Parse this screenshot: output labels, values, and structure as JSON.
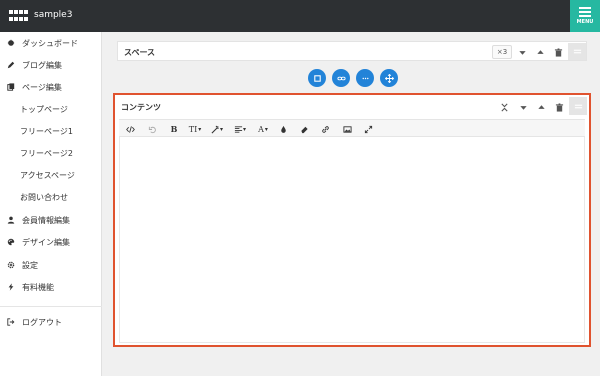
{
  "header": {
    "site_name": "sample3",
    "menu_label": "MENU",
    "colors": {
      "bar": "#2d3033",
      "menu": "#26b8a1"
    }
  },
  "sidebar": {
    "items": [
      {
        "label": "ダッシュボード",
        "icon": "dashboard-icon"
      },
      {
        "label": "ブログ編集",
        "icon": "pencil-icon"
      },
      {
        "label": "ページ編集",
        "icon": "pages-icon"
      },
      {
        "label": "トップページ"
      },
      {
        "label": "フリーページ1"
      },
      {
        "label": "フリーページ2"
      },
      {
        "label": "アクセスページ"
      },
      {
        "label": "お問い合わせ"
      },
      {
        "label": "会員情報編集",
        "icon": "user-icon"
      },
      {
        "label": "デザイン編集",
        "icon": "palette-icon"
      },
      {
        "label": "設定",
        "icon": "gear-icon"
      },
      {
        "label": "有料機能",
        "icon": "bolt-icon"
      }
    ],
    "logout": {
      "label": "ログアウト",
      "icon": "logout-icon"
    }
  },
  "space_block": {
    "title": "スペース",
    "multiplier": "×3"
  },
  "add_buttons": [
    {
      "icon": "square-icon"
    },
    {
      "icon": "link-icon"
    },
    {
      "icon": "ellipsis-icon"
    },
    {
      "icon": "move-icon"
    }
  ],
  "content_block": {
    "title": "コンテンツ",
    "highlight_color": "#e0532f",
    "toolbar": {
      "bold": "B",
      "text_size": "TI",
      "font_color": "A"
    }
  }
}
